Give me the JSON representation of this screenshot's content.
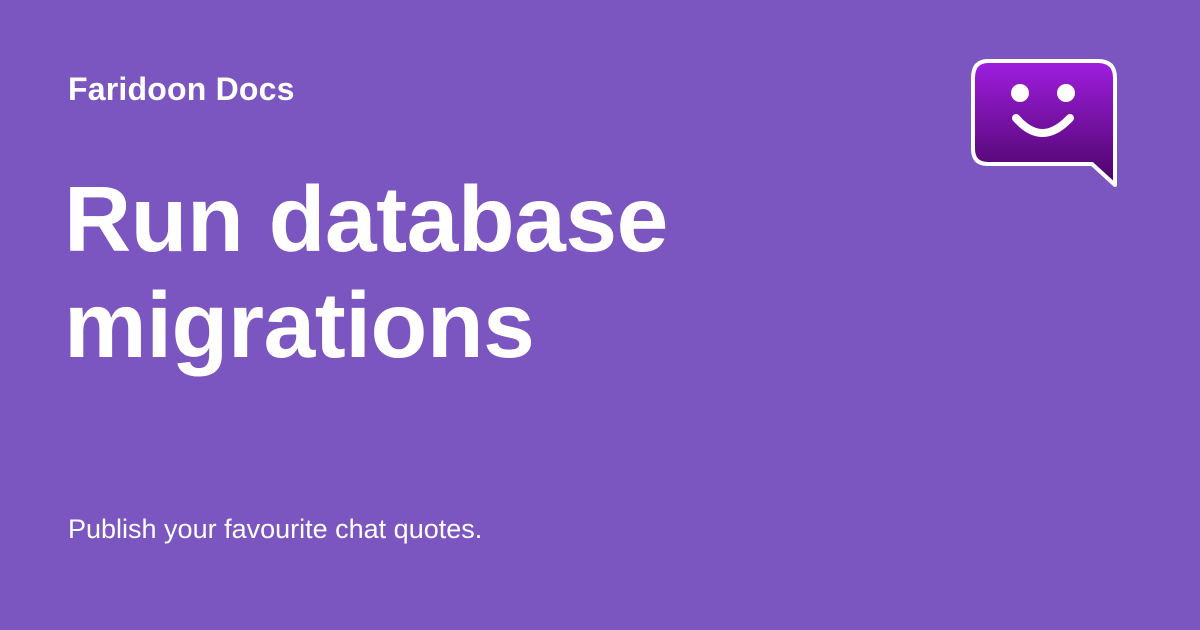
{
  "site": {
    "name": "Faridoon Docs"
  },
  "page": {
    "title": "Run database migrations",
    "tagline": "Publish your favourite chat quotes."
  },
  "logo": {
    "icon": "smiley-chat-bubble-icon"
  },
  "colors": {
    "background": "#7c56c0",
    "text": "#ffffff",
    "logo_top": "#a01ee0",
    "logo_bottom": "#4a0466"
  }
}
